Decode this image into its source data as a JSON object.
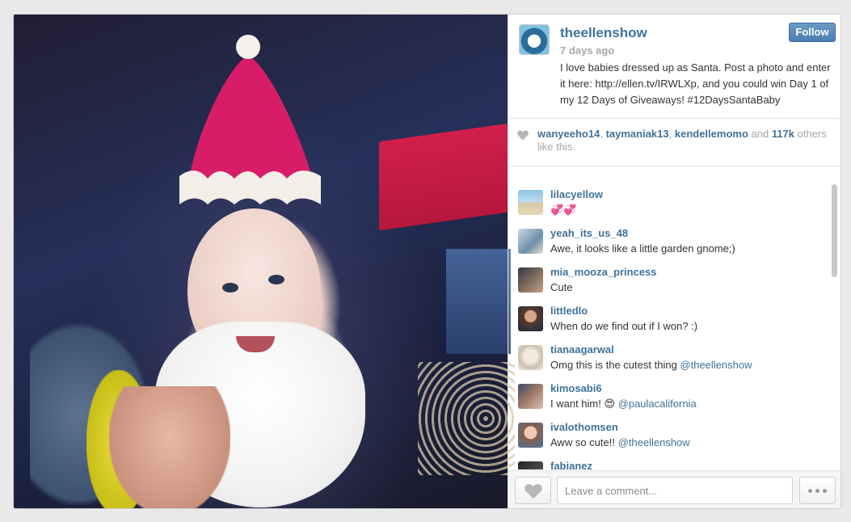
{
  "post": {
    "username": "theellenshow",
    "time_ago": "7 days ago",
    "caption": "I love babies dressed up as Santa. Post a photo and enter it here: http://ellen.tv/IRWLXp, and you could win Day 1 of my 12 Days of Giveaways! #12DaysSantaBaby",
    "follow_label": "Follow",
    "brand_color": "#3f729b"
  },
  "likes": {
    "users": [
      "wanyeeho14",
      "taymaniak13",
      "kendellemomo"
    ],
    "separator": ", ",
    "and_text": " and ",
    "count": "117k",
    "suffix": " others like this."
  },
  "comments": [
    {
      "user": "lilacyellow",
      "text": "💞💞",
      "mention": ""
    },
    {
      "user": "yeah_its_us_48",
      "text": "Awe, it looks like a little garden gnome;)",
      "mention": ""
    },
    {
      "user": "mia_mooza_princess",
      "text": "Cute",
      "mention": ""
    },
    {
      "user": "littledlo",
      "text": "When do we find out if I won? :)",
      "mention": ""
    },
    {
      "user": "tianaagarwal",
      "text": "Omg this is the cutest thing ",
      "mention": "@theellenshow"
    },
    {
      "user": "kimosabi6",
      "text": "I want him! 😍 ",
      "mention": "@paulacalifornia"
    },
    {
      "user": "ivalothomsen",
      "text": "Aww so cute!! ",
      "mention": "@theellenshow"
    },
    {
      "user": "fabianez",
      "text": "",
      "mention": ""
    }
  ],
  "footer": {
    "comment_placeholder": "Leave a comment..."
  },
  "icons": {
    "like": "heart-icon",
    "more": "more-dots-icon"
  }
}
